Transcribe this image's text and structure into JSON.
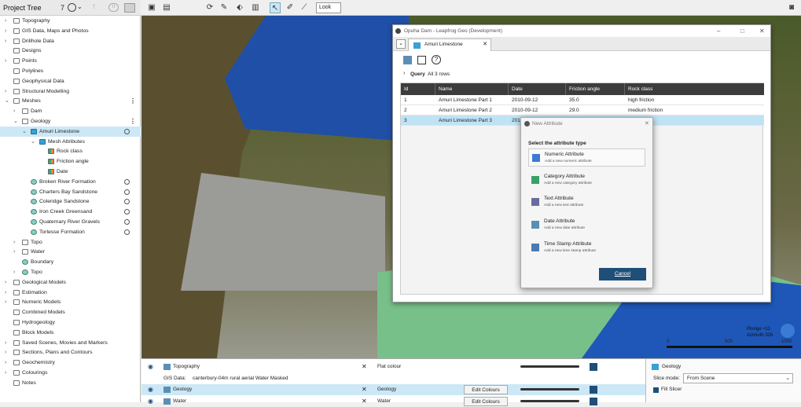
{
  "project_tree": {
    "title": "Project Tree",
    "counter": "7",
    "items": [
      {
        "label": "Topography",
        "indent": 0,
        "caret": "›",
        "icon": "folder"
      },
      {
        "label": "GIS Data, Maps and Photos",
        "indent": 0,
        "caret": "›",
        "icon": "folder"
      },
      {
        "label": "Drillhole Data",
        "indent": 0,
        "caret": "›",
        "icon": "folder"
      },
      {
        "label": "Designs",
        "indent": 0,
        "caret": "",
        "icon": "folder"
      },
      {
        "label": "Points",
        "indent": 0,
        "caret": "›",
        "icon": "folder"
      },
      {
        "label": "Polylines",
        "indent": 0,
        "caret": "",
        "icon": "folder"
      },
      {
        "label": "Geophysical Data",
        "indent": 0,
        "caret": "",
        "icon": "folder"
      },
      {
        "label": "Structural Modelling",
        "indent": 0,
        "caret": "›",
        "icon": "folder"
      },
      {
        "label": "Meshes",
        "indent": 0,
        "caret": "⌄",
        "icon": "folder",
        "dots": true
      },
      {
        "label": "Dam",
        "indent": 1,
        "caret": "›",
        "icon": "folder"
      },
      {
        "label": "Geology",
        "indent": 1,
        "caret": "⌄",
        "icon": "folder",
        "dots": true
      },
      {
        "label": "Amuri Limestone",
        "indent": 2,
        "caret": "⌄",
        "icon": "mesh",
        "clock": true,
        "selected": true
      },
      {
        "label": "Mesh Attributes",
        "indent": 3,
        "caret": "⌄",
        "icon": "mesh"
      },
      {
        "label": "Rock class",
        "indent": 4,
        "caret": "",
        "icon": "mat"
      },
      {
        "label": "Friction angle",
        "indent": 4,
        "caret": "",
        "icon": "mat"
      },
      {
        "label": "Date",
        "indent": 4,
        "caret": "",
        "icon": "mat"
      },
      {
        "label": "Broken River Formation",
        "indent": 2,
        "caret": "",
        "icon": "geo",
        "clock": true
      },
      {
        "label": "Charters Bay Sandstone",
        "indent": 2,
        "caret": "",
        "icon": "geo",
        "clock": true
      },
      {
        "label": "Coleridge Sandstone",
        "indent": 2,
        "caret": "",
        "icon": "geo",
        "clock": true
      },
      {
        "label": "Iron Creek Greensand",
        "indent": 2,
        "caret": "",
        "icon": "geo",
        "clock": true
      },
      {
        "label": "Quaternary River Gravels",
        "indent": 2,
        "caret": "",
        "icon": "geo",
        "clock": true
      },
      {
        "label": "Torlesse Formation",
        "indent": 2,
        "caret": "",
        "icon": "geo",
        "clock": true
      },
      {
        "label": "Topo",
        "indent": 1,
        "caret": "›",
        "icon": "folder"
      },
      {
        "label": "Water",
        "indent": 1,
        "caret": "›",
        "icon": "folder"
      },
      {
        "label": "Boundary",
        "indent": 1,
        "caret": "",
        "icon": "geo"
      },
      {
        "label": "Topo",
        "indent": 1,
        "caret": "›",
        "icon": "geo"
      },
      {
        "label": "Geological Models",
        "indent": 0,
        "caret": "›",
        "icon": "folder"
      },
      {
        "label": "Estimation",
        "indent": 0,
        "caret": "›",
        "icon": "folder"
      },
      {
        "label": "Numeric Models",
        "indent": 0,
        "caret": "›",
        "icon": "folder"
      },
      {
        "label": "Combined Models",
        "indent": 0,
        "caret": "",
        "icon": "folder"
      },
      {
        "label": "Hydrogeology",
        "indent": 0,
        "caret": "",
        "icon": "folder"
      },
      {
        "label": "Block Models",
        "indent": 0,
        "caret": "",
        "icon": "folder"
      },
      {
        "label": "Saved Scenes, Movies and Markers",
        "indent": 0,
        "caret": "›",
        "icon": "folder"
      },
      {
        "label": "Sections, Plans and Contours",
        "indent": 0,
        "caret": "›",
        "icon": "folder"
      },
      {
        "label": "Geochemistry",
        "indent": 0,
        "caret": "›",
        "icon": "folder"
      },
      {
        "label": "Colourings",
        "indent": 0,
        "caret": "›",
        "icon": "folder"
      },
      {
        "label": "Notes",
        "indent": 0,
        "caret": "",
        "icon": "folder"
      }
    ]
  },
  "toolbar": {
    "look_label": "Look"
  },
  "window": {
    "title": "Opuha Dam - Leapfrog Geo (Development)",
    "tab_label": "Amuri Limestone",
    "query_label": "Query",
    "query_count": "All 3 rows"
  },
  "table": {
    "columns": [
      "Id",
      "Name",
      "Date",
      "Friction angle",
      "Rock class"
    ],
    "rows": [
      [
        "1",
        "Amuri Limestone Part 1",
        "2010-09-12",
        "35.0",
        "high friction"
      ],
      [
        "2",
        "Amuri Limestone Part 2",
        "2010-09-12",
        "29.0",
        "medium friction"
      ],
      [
        "3",
        "Amuri Limestone Part 3",
        "201",
        "",
        "riction"
      ]
    ]
  },
  "new_attribute": {
    "title": "New Attribute",
    "heading": "Select the attribute type",
    "options": [
      {
        "title": "Numeric Attribute",
        "desc": "Add a new numeric attribute"
      },
      {
        "title": "Category Attribute",
        "desc": "Add a new category attribute"
      },
      {
        "title": "Text Attribute",
        "desc": "Add a new text attribute"
      },
      {
        "title": "Date Attribute",
        "desc": "Add a new date attribute"
      },
      {
        "title": "Time Stamp Attribute",
        "desc": "Add a new time stamp attribute"
      }
    ],
    "cancel_label": "Cancel"
  },
  "shown_objects": {
    "rows": [
      {
        "name": "Topography",
        "colouring": "Flat colour",
        "button": ""
      },
      {
        "name": "GIS Data:",
        "colouring": "",
        "button": "",
        "extra": "canterbury-04m rural aerial Water Masked"
      },
      {
        "name": "Geology",
        "colouring": "Geology",
        "button": "Edit Colours"
      },
      {
        "name": "Water",
        "colouring": "Water",
        "button": "Edit Colours"
      }
    ]
  },
  "properties": {
    "object_name": "Geology",
    "slice_mode_label": "Slice mode:",
    "slice_mode_value": "From Scene",
    "fill_slicer_label": "Fill Slicer"
  },
  "scene": {
    "plunge": "Plunge +11",
    "azimuth": "Azimuth 326",
    "scale_start": "0",
    "scale_mid": "500",
    "scale_end": "1000"
  },
  "colors": {
    "accent": "#1f4e79",
    "selection": "#cce8f6",
    "table_header": "#3c3c3c"
  }
}
